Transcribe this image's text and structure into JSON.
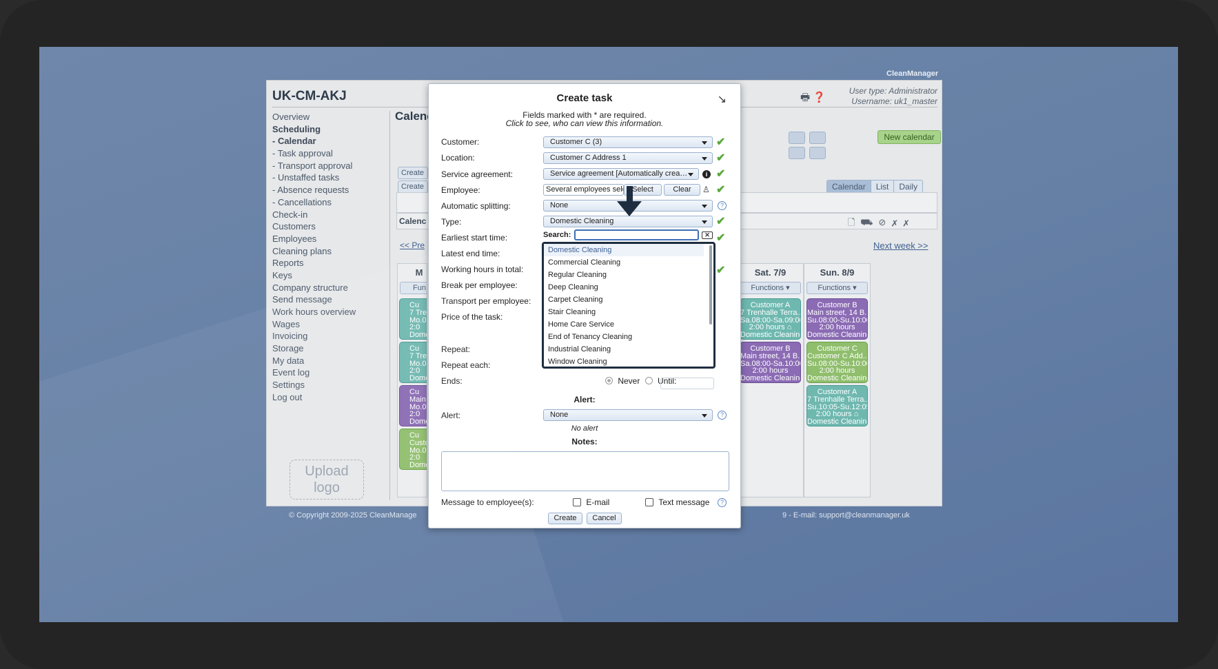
{
  "brand": "CleanManager",
  "app": {
    "title": "UK-CM-AKJ",
    "user_type": "User type: Administrator",
    "username": "Username: uk1_master",
    "upload_logo": "Upload logo",
    "main_heading": "Calenc",
    "new_calendar": "New calendar",
    "view_tabs": [
      "Calendar",
      "List",
      "Daily"
    ],
    "create_buttons": [
      "Create",
      "Create"
    ],
    "calendar_bar": "Calenc",
    "prev_week": "<< Pre",
    "next_week": "Next week >>",
    "copyright": "© Copyright 2009-2025 CleanManage",
    "contact": "9 - E-mail: support@cleanmanager.uk"
  },
  "nav": [
    {
      "label": "Overview",
      "bold": false
    },
    {
      "label": "Scheduling",
      "bold": true
    },
    {
      "label": " - Calendar",
      "bold": true
    },
    {
      "label": " - Task approval",
      "bold": false
    },
    {
      "label": " - Transport approval",
      "bold": false
    },
    {
      "label": " - Unstaffed tasks",
      "bold": false
    },
    {
      "label": " - Absence requests",
      "bold": false
    },
    {
      "label": " - Cancellations",
      "bold": false
    },
    {
      "label": "Check-in",
      "bold": false
    },
    {
      "label": "Customers",
      "bold": false
    },
    {
      "label": "Employees",
      "bold": false
    },
    {
      "label": "Cleaning plans",
      "bold": false
    },
    {
      "label": "Reports",
      "bold": false
    },
    {
      "label": "Keys",
      "bold": false
    },
    {
      "label": "Company structure",
      "bold": false
    },
    {
      "label": "Send message",
      "bold": false
    },
    {
      "label": "Work hours overview",
      "bold": false
    },
    {
      "label": "Wages",
      "bold": false
    },
    {
      "label": "Invoicing",
      "bold": false
    },
    {
      "label": "Storage",
      "bold": false
    },
    {
      "label": "My data",
      "bold": false
    },
    {
      "label": "Event log",
      "bold": false
    },
    {
      "label": "Settings",
      "bold": false
    },
    {
      "label": "Log out",
      "bold": false
    }
  ],
  "partial_column": {
    "header": "M",
    "functions": "Fun",
    "tasks": [
      {
        "color": "teal",
        "lines": [
          "Cu",
          "7 Trenh",
          "Mo.08:",
          "2:0",
          "Domes"
        ]
      },
      {
        "color": "teal",
        "lines": [
          "Cu",
          "7 Trenh",
          "Mo.08:",
          "2:0",
          "Domes"
        ]
      },
      {
        "color": "purple",
        "lines": [
          "Cu",
          "Main st",
          "Mo.08:",
          "2:0",
          "Domes"
        ]
      },
      {
        "color": "green",
        "lines": [
          "Cu",
          "Custom",
          "Mo.08:",
          "2:0",
          "Domes"
        ]
      }
    ]
  },
  "days": [
    {
      "header": "Sat. 7/9",
      "functions": "Functions",
      "tasks": [
        {
          "color": "teal",
          "lines": [
            "Customer A",
            "7 Trenhalle Terra...",
            "Sa.08:00-Sa.09:00",
            "2:00 hours ⌂",
            "Domestic Cleaning"
          ]
        },
        {
          "color": "purple",
          "lines": [
            "Customer B",
            "Main street, 14 B...",
            "Sa.08:00-Sa.10:00",
            "2:00 hours",
            "Domestic Cleaning"
          ]
        }
      ]
    },
    {
      "header": "Sun. 8/9",
      "functions": "Functions",
      "tasks": [
        {
          "color": "purple",
          "lines": [
            "Customer B",
            "Main street, 14 B...",
            "Su.08:00-Su.10:00",
            "2:00 hours",
            "Domestic Cleaning"
          ]
        },
        {
          "color": "green",
          "lines": [
            "Customer C",
            "Customer C Add...",
            "Su.08:00-Su.10:00",
            "2:00 hours",
            "Domestic Cleaning"
          ]
        },
        {
          "color": "teal",
          "lines": [
            "Customer A",
            "7 Trenhalle Terra...",
            "Su.10:05-Su.12:05",
            "2:00 hours ⌂",
            "Domestic Cleaning"
          ]
        }
      ]
    }
  ],
  "modal": {
    "title": "Create task",
    "note_required": "Fields marked with * are required.",
    "note_click": "Click to see, who can view this information.",
    "labels": {
      "customer": "Customer:",
      "location": "Location:",
      "service_agreement": "Service agreement:",
      "employee": "Employee:",
      "automatic_splitting": "Automatic splitting:",
      "type": "Type:",
      "earliest_start": "Earliest start time:",
      "latest_end": "Latest end time:",
      "working_hours": "Working hours in total:",
      "break": "Break per employee:",
      "transport": "Transport per employee:",
      "price": "Price of the task:",
      "repeat": "Repeat:",
      "repeat_each": "Repeat each:",
      "ends": "Ends:",
      "alert_section": "Alert:",
      "alert": "Alert:",
      "notes": "Notes:",
      "message": "Message to employee(s):"
    },
    "values": {
      "customer": "Customer C (3)",
      "location": "Customer C Address 1",
      "service_agreement": "Service agreement [Automatically crea…",
      "employee": "Several employees sele",
      "automatic_splitting": "None",
      "type": "Domestic Cleaning",
      "alert": "None"
    },
    "employee_select": "Select",
    "employee_clear": "Clear",
    "search_label": "Search:",
    "search_value": "",
    "type_options": [
      "Domestic Cleaning",
      "Commercial Cleaning",
      "Regular Cleaning",
      "Deep Cleaning",
      "Carpet Cleaning",
      "Stair Cleaning",
      "Home Care Service",
      "End of Tenancy Cleaning",
      "Industrial Cleaning",
      "Window Cleaning"
    ],
    "ends_never": "Never",
    "ends_until": "Until:",
    "no_alert": "No alert",
    "email": "E-mail",
    "text_message": "Text message",
    "create": "Create",
    "cancel": "Cancel"
  }
}
